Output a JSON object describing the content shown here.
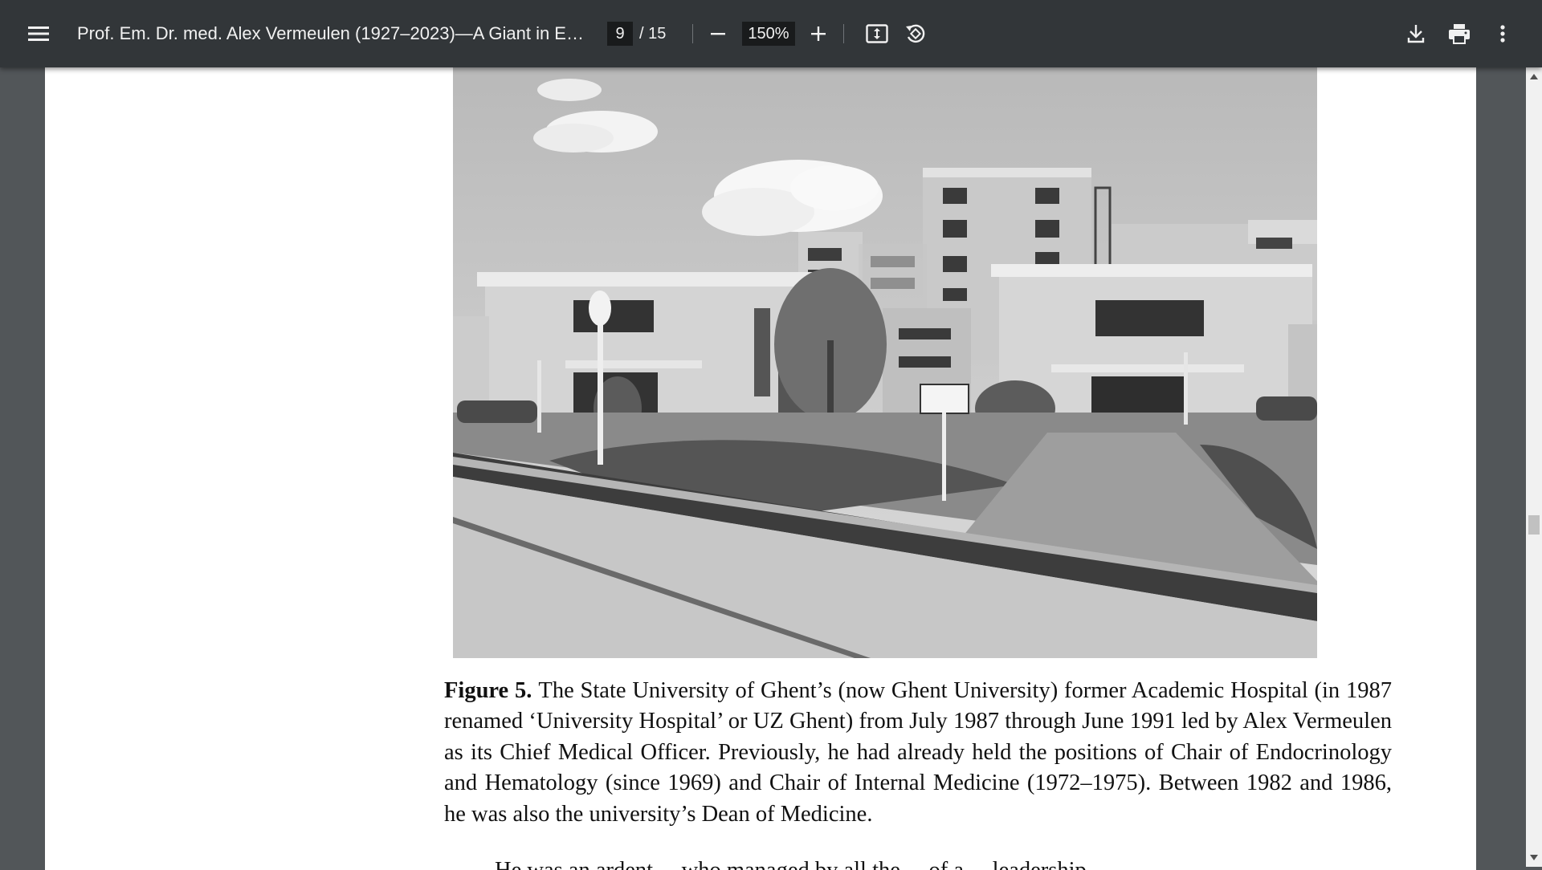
{
  "toolbar": {
    "title": "Prof. Em. Dr. med. Alex Vermeulen (1927–2023)—A Giant in Endo...",
    "current_page": "9",
    "total_pages": "/ 15",
    "zoom": "150%",
    "icons": {
      "menu": "hamburger-menu-icon",
      "zoom_out": "minus-icon",
      "zoom_in": "plus-icon",
      "fit": "fit-to-page-icon",
      "rotate": "rotate-counterclockwise-icon",
      "download": "download-icon",
      "print": "printer-icon",
      "more": "more-vertical-icon"
    },
    "colors": {
      "toolbar_bg": "#323639",
      "viewer_bg": "#525659",
      "text": "#f1f1f1"
    }
  },
  "document": {
    "figure": {
      "label": "Figure 5.",
      "caption": "The State University of Ghent’s (now Ghent University) former Academic Hospital (in 1987 renamed ‘University Hospital’ or UZ Ghent) from July 1987 through June 1991 led by Alex Vermeulen as its Chief Medical Officer. Previously, he had already held the positions of Chair of Endocrinology and Hematology (since 1969) and Chair of Internal Medicine (1972–1975). Between 1982 and 1986, he was also the university’s Dean of Medicine."
    },
    "next_paragraph_fragment": "He was an ardent ... who managed by all the ... of a ... leadership"
  }
}
